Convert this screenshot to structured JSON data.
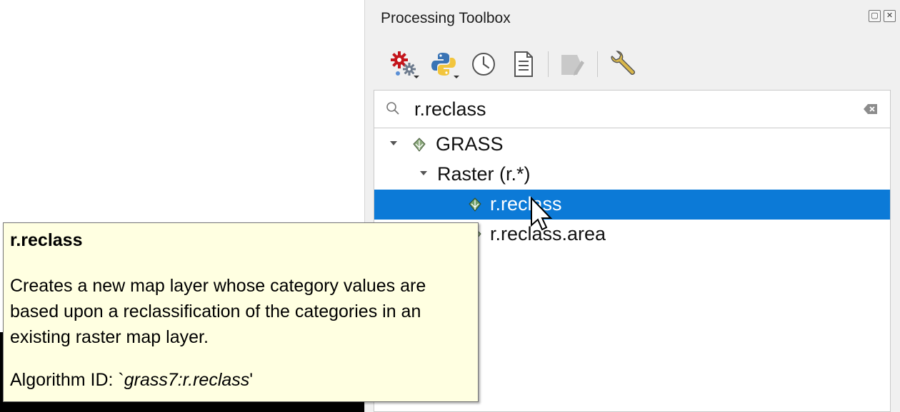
{
  "panel": {
    "title": "Processing Toolbox",
    "title_buttons": [
      "float-icon",
      "close-icon"
    ]
  },
  "toolbar": {
    "buttons": [
      {
        "name": "models-icon",
        "has_dropdown": true
      },
      {
        "name": "python-scripts-icon",
        "has_dropdown": true
      },
      {
        "name": "history-icon",
        "has_dropdown": false
      },
      {
        "name": "results-viewer-icon",
        "has_dropdown": false
      },
      {
        "name": "edit-features-in-place-icon",
        "has_dropdown": false,
        "disabled": true
      },
      {
        "name": "options-wrench-icon",
        "has_dropdown": false
      }
    ]
  },
  "search": {
    "value": "r.reclass"
  },
  "tree": {
    "provider": "GRASS",
    "group": "Raster (r.*)",
    "items": [
      {
        "label": "r.reclass",
        "selected": true
      },
      {
        "label": "r.reclass.area",
        "selected": false
      }
    ]
  },
  "tooltip": {
    "title": "r.reclass",
    "description": "Creates a new map layer whose category values are based upon a reclassification of the categories in an existing raster map layer.",
    "id_prefix": "Algorithm ID: `",
    "id_value": "grass7:r.reclass",
    "id_suffix": "'"
  },
  "colors": {
    "selection": "#0c7ad7",
    "tooltip_bg": "#ffffe1",
    "panel_bg": "#f0f0f0"
  }
}
